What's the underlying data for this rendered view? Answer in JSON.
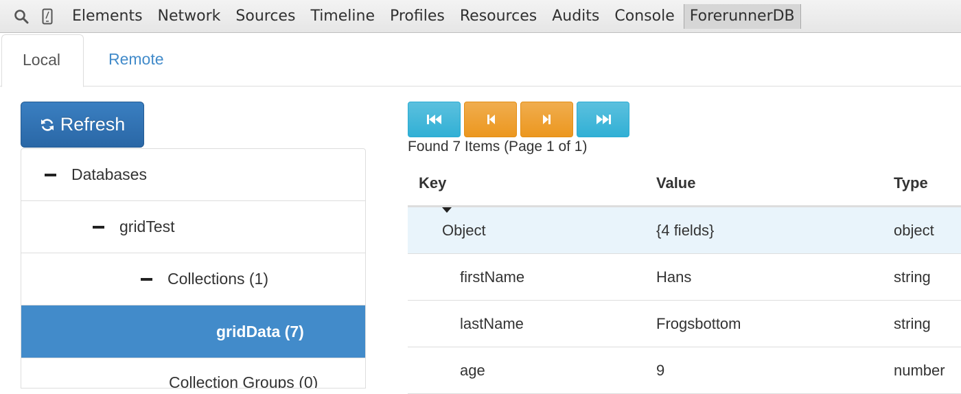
{
  "devtools": {
    "tabs": [
      "Elements",
      "Network",
      "Sources",
      "Timeline",
      "Profiles",
      "Resources",
      "Audits",
      "Console",
      "ForerunnerDB"
    ],
    "active_tab": "ForerunnerDB"
  },
  "nav": {
    "local": "Local",
    "remote": "Remote"
  },
  "sidebar": {
    "refresh_label": "Refresh",
    "tree": [
      {
        "label": "Databases",
        "expanded": true
      },
      {
        "label": "gridTest",
        "expanded": true
      },
      {
        "label": "Collections (1)",
        "expanded": true
      },
      {
        "label": "gridData (7)",
        "selected": true
      },
      {
        "label": "Collection Groups (0)"
      }
    ]
  },
  "main": {
    "found_text": "Found 7 Items (Page 1 of 1)",
    "columns": {
      "key": "Key",
      "value": "Value",
      "type": "Type"
    },
    "rows": [
      {
        "key": "Object",
        "value": "{4 fields}",
        "type": "object"
      },
      {
        "key": "firstName",
        "value": "Hans",
        "type": "string"
      },
      {
        "key": "lastName",
        "value": "Frogsbottom",
        "type": "string"
      },
      {
        "key": "age",
        "value": "9",
        "type": "number"
      }
    ]
  },
  "colors": {
    "primary": "#428bca",
    "info": "#5bc0de",
    "warning": "#f0ad4e",
    "row_highlight": "#e9f4fb"
  }
}
